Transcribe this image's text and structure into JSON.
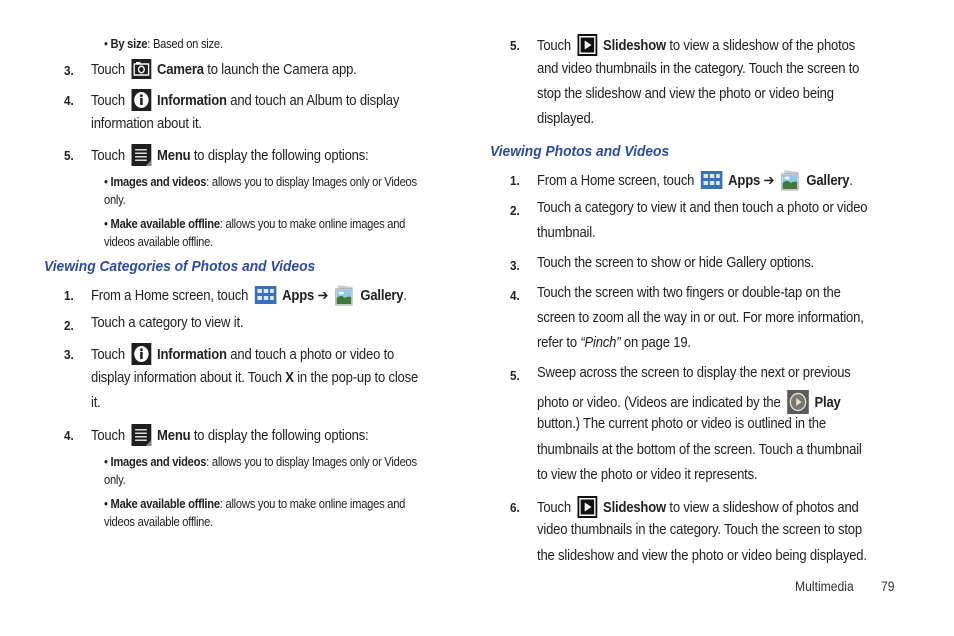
{
  "left": {
    "bullet_by_size": {
      "bold": "By size",
      "text": ": Based on size."
    },
    "item3": {
      "num": "3.",
      "pre": "Touch",
      "icon": "camera-icon",
      "bold": "Camera",
      "post": " to launch the Camera app."
    },
    "item4": {
      "num": "4.",
      "pre": "Touch",
      "icon": "information-icon",
      "bold": "Information",
      "post": " and touch an Album to display",
      "line2": "information about it."
    },
    "item5": {
      "num": "5.",
      "pre": "Touch",
      "icon": "menu-icon",
      "bold": "Menu",
      "post": " to display the following options:"
    },
    "item5_bullets": [
      {
        "bold": "Images and videos",
        "text": ": allows you to display Images only or Videos",
        "line2": "only."
      },
      {
        "bold": "Make available offline",
        "text": ": allows you to make online images and",
        "line2": "videos available offline."
      }
    ],
    "section_heading": "Viewing Categories of Photos and Videos",
    "steps": {
      "s1": {
        "num": "1.",
        "pre": "From a Home screen, touch",
        "bold1": "Apps",
        "arrow": " ➔ ",
        "bold2": "Gallery",
        "end": "."
      },
      "s2": {
        "num": "2.",
        "text": "Touch a category to view it."
      },
      "s3": {
        "num": "3.",
        "pre": "Touch",
        "bold": "Information",
        "post": " and touch a photo or video to",
        "line2a": "display information about it. Touch ",
        "line2b": "X",
        "line2c": " in the pop-up to close",
        "line3": "it."
      },
      "s4": {
        "num": "4.",
        "pre": "Touch",
        "bold": "Menu",
        "post": " to display the following options:"
      },
      "s4_bullets": [
        {
          "bold": "Images and videos",
          "text": ": allows you to display Images only or Videos",
          "line2": "only."
        },
        {
          "bold": "Make available offline",
          "text": ": allows you to make online images and",
          "line2": "videos available offline."
        }
      ]
    }
  },
  "right": {
    "item5": {
      "num": "5.",
      "pre": "Touch",
      "bold": "Slideshow",
      "post": " to view a slideshow of the photos",
      "line2": "and video thumbnails in the category. Touch the screen to",
      "line3": "stop the slideshow and view the photo or video being",
      "line4": "displayed."
    },
    "section_heading": "Viewing Photos and Videos",
    "steps": {
      "s1": {
        "num": "1.",
        "pre": "From a Home screen, touch",
        "bold1": "Apps",
        "arrow": " ➔ ",
        "bold2": "Gallery",
        "end": "."
      },
      "s2": {
        "num": "2.",
        "text": "Touch a category to view it and then touch a photo or video",
        "line2": "thumbnail."
      },
      "s3": {
        "num": "3.",
        "text": "Touch the screen to show or hide Gallery options."
      },
      "s4": {
        "num": "4.",
        "text": "Touch the screen with two fingers or double-tap on the",
        "line2": "screen to zoom all the way in or out. For more information,",
        "line3a": "refer to ",
        "line3b": "“Pinch”",
        "line3c": "  on page 19."
      },
      "s5": {
        "num": "5.",
        "text": "Sweep across the screen to display the next or previous",
        "line2a": "photo or video. (Videos are indicated by the",
        "line2b": "Play",
        "line3": "button.) The current photo or video is outlined in the",
        "line4": "thumbnails at the bottom of the screen. Touch a thumbnail",
        "line5": "to view the photo or video it represents."
      },
      "s6": {
        "num": "6.",
        "pre": "Touch",
        "bold": "Slideshow",
        "post": " to view a slideshow of photos and",
        "line2": "video thumbnails in the category. Touch the screen to stop",
        "line3": "the slideshow and view the photo or video being displayed."
      }
    }
  },
  "footer": {
    "section": "Multimedia",
    "page": "79"
  },
  "colors": {
    "heading": "#2e4aa3",
    "apps_icon": "#3a6fc0"
  }
}
